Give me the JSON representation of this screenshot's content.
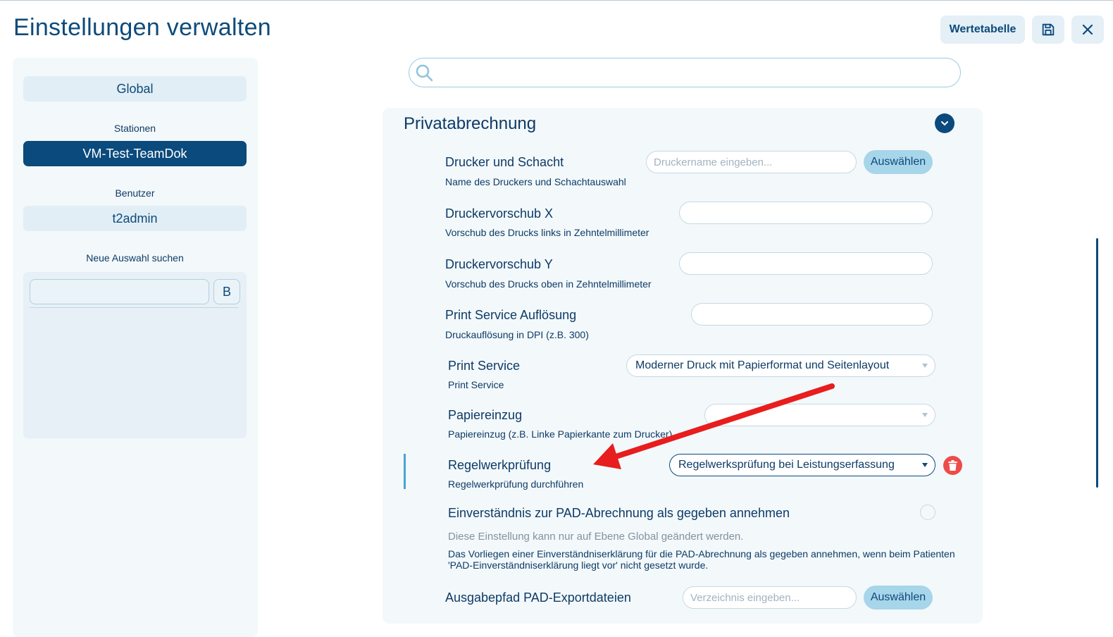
{
  "header": {
    "title": "Einstellungen verwalten",
    "wertetabelle_label": "Wertetabelle",
    "save_icon": "save-icon",
    "close_icon": "close-icon"
  },
  "sidebar": {
    "global_label": "Global",
    "stations_heading": "Stationen",
    "station_selected": "VM-Test-TeamDok",
    "users_heading": "Benutzer",
    "user_selected": "t2admin",
    "search_heading": "Neue Auswahl suchen",
    "search_value": "",
    "search_button": "B"
  },
  "search": {
    "value": "",
    "icon": "search-icon"
  },
  "section": {
    "title": "Privatabrechnung",
    "collapse_icon": "chevron-down-icon",
    "settings": [
      {
        "title": "Drucker und Schacht",
        "desc": "Name des Druckers und Schachtauswahl",
        "placeholder": "Druckername eingeben...",
        "button": "Auswählen"
      },
      {
        "title": "Druckervorschub X",
        "desc": "Vorschub des Drucks links in Zehntelmillimeter",
        "value": ""
      },
      {
        "title": "Druckervorschub Y",
        "desc": "Vorschub des Drucks oben in Zehntelmillimeter",
        "value": ""
      },
      {
        "title": "Print Service Auflösung",
        "desc": "Druckauflösung in DPI (z.B. 300)",
        "value": ""
      },
      {
        "title": "Print Service",
        "desc": "Print Service",
        "selected": "Moderner Druck mit Papierformat und Seitenlayout"
      },
      {
        "title": "Papiereinzug",
        "desc": "Papiereinzug (z.B. Linke Papierkante zum Drucker)",
        "selected": ""
      },
      {
        "title": "Regelwerkprüfung",
        "desc": "Regelwerkprüfung durchführen",
        "selected": "Regelwerksprüfung bei Leistungserfassung",
        "delete_icon": "trash-icon"
      },
      {
        "title": "Einverständnis zur PAD-Abrechnung als gegeben annehmen",
        "note": "Diese Einstellung kann nur auf Ebene Global geändert werden.",
        "desc_line1": "Das Vorliegen einer Einverständniserklärung für die PAD-Abrechnung als gegeben annehmen, wenn beim Patienten",
        "desc_line2": "'PAD-Einverständniserklärung liegt vor' nicht gesetzt wurde.",
        "checked": false
      },
      {
        "title": "Ausgabepfad PAD-Exportdateien",
        "placeholder": "Verzeichnis eingeben...",
        "button": "Auswählen"
      }
    ]
  },
  "colors": {
    "primary": "#0b4a7c",
    "accent_button": "#a7d5ea",
    "danger": "#ee4b4b",
    "annotation_arrow": "#e81d1d"
  }
}
